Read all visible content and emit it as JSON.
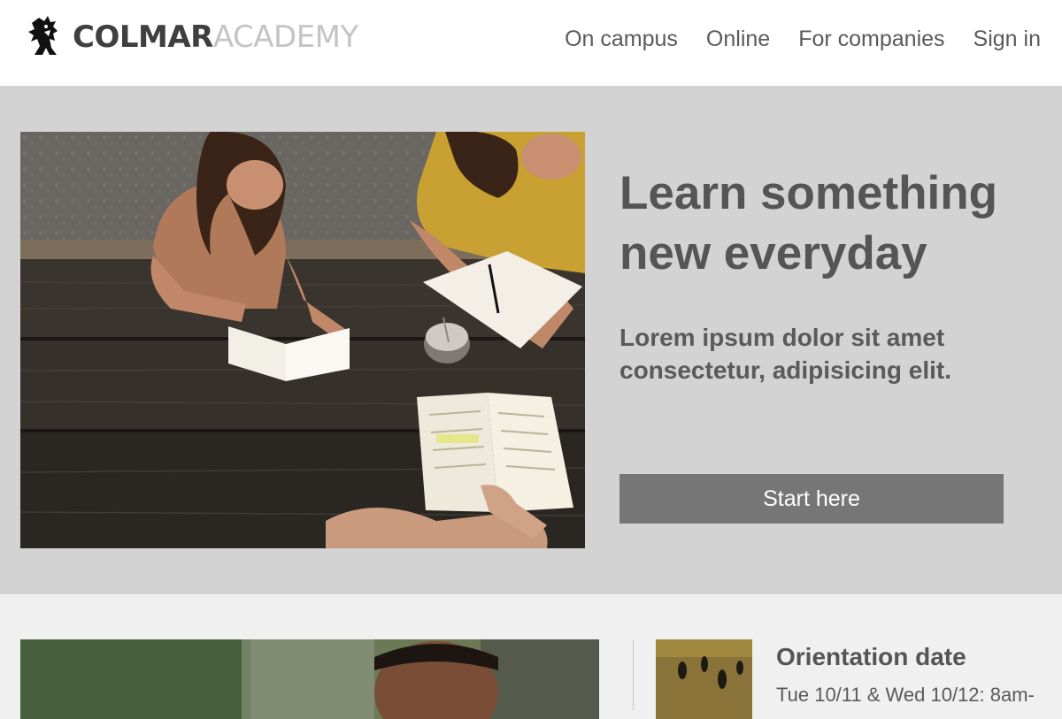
{
  "brand": {
    "name_bold": "COLMAR",
    "name_light": "ACADEMY"
  },
  "nav": {
    "items": [
      {
        "label": "On campus"
      },
      {
        "label": "Online"
      },
      {
        "label": "For companies"
      },
      {
        "label": "Sign in"
      }
    ]
  },
  "hero": {
    "title": "Learn something new everyday",
    "subtitle": "Lorem ipsum dolor sit amet consectetur, adipisicing elit.",
    "cta_label": "Start here"
  },
  "events": {
    "title": "Orientation date",
    "date": "Tue 10/11 & Wed 10/12: 8am-"
  },
  "colors": {
    "header_bg": "#ffffff",
    "hero_bg": "#d3d3d3",
    "lower_bg": "#f0f0f0",
    "cta_bg": "#767676",
    "heading_text": "#555555"
  },
  "icons": {
    "logo": "griffin-logo-icon"
  }
}
